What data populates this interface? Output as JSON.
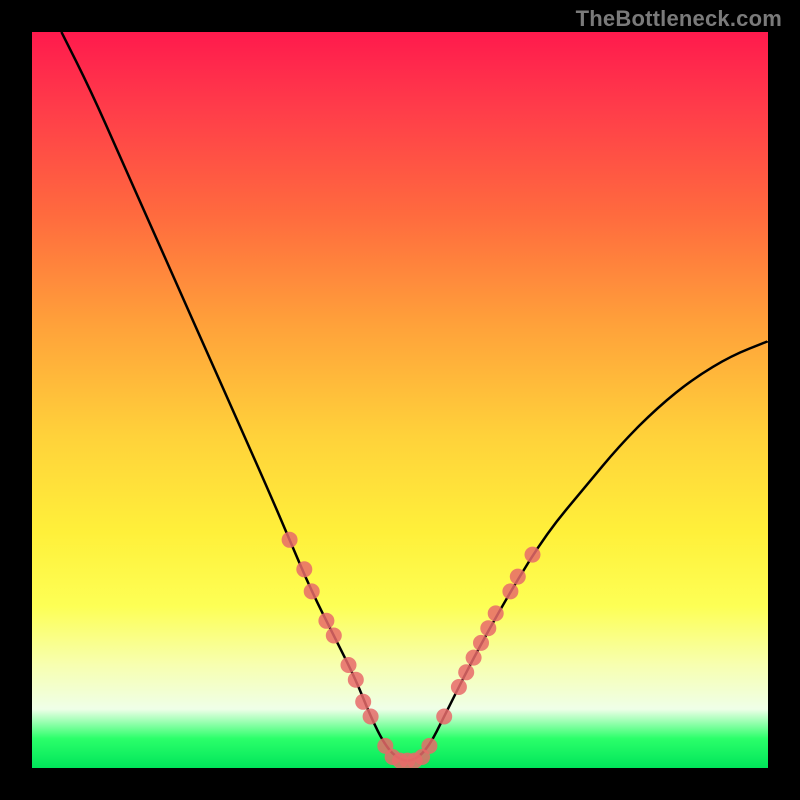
{
  "watermark": "TheBottleneck.com",
  "chart_data": {
    "type": "line",
    "title": "",
    "xlabel": "",
    "ylabel": "",
    "xlim": [
      0,
      100
    ],
    "ylim": [
      0,
      100
    ],
    "series": [
      {
        "name": "bottleneck-curve",
        "x": [
          4,
          8,
          12,
          16,
          20,
          24,
          28,
          32,
          35,
          38,
          41,
          44,
          46,
          48,
          50,
          52,
          54,
          56,
          60,
          65,
          70,
          75,
          80,
          85,
          90,
          95,
          100
        ],
        "values": [
          100,
          92,
          83,
          74,
          65,
          56,
          47,
          38,
          31,
          24,
          18,
          12,
          7,
          3,
          1,
          1,
          3,
          7,
          15,
          24,
          32,
          38,
          44,
          49,
          53,
          56,
          58
        ]
      }
    ],
    "markers": {
      "name": "highlighted-points",
      "color": "#e86a6a",
      "points": [
        {
          "x": 35,
          "y": 31
        },
        {
          "x": 37,
          "y": 27
        },
        {
          "x": 38,
          "y": 24
        },
        {
          "x": 40,
          "y": 20
        },
        {
          "x": 41,
          "y": 18
        },
        {
          "x": 43,
          "y": 14
        },
        {
          "x": 44,
          "y": 12
        },
        {
          "x": 45,
          "y": 9
        },
        {
          "x": 46,
          "y": 7
        },
        {
          "x": 48,
          "y": 3
        },
        {
          "x": 49,
          "y": 1.5
        },
        {
          "x": 50,
          "y": 1
        },
        {
          "x": 51,
          "y": 1
        },
        {
          "x": 52,
          "y": 1
        },
        {
          "x": 53,
          "y": 1.5
        },
        {
          "x": 54,
          "y": 3
        },
        {
          "x": 56,
          "y": 7
        },
        {
          "x": 58,
          "y": 11
        },
        {
          "x": 59,
          "y": 13
        },
        {
          "x": 60,
          "y": 15
        },
        {
          "x": 61,
          "y": 17
        },
        {
          "x": 62,
          "y": 19
        },
        {
          "x": 63,
          "y": 21
        },
        {
          "x": 65,
          "y": 24
        },
        {
          "x": 66,
          "y": 26
        },
        {
          "x": 68,
          "y": 29
        }
      ]
    }
  }
}
